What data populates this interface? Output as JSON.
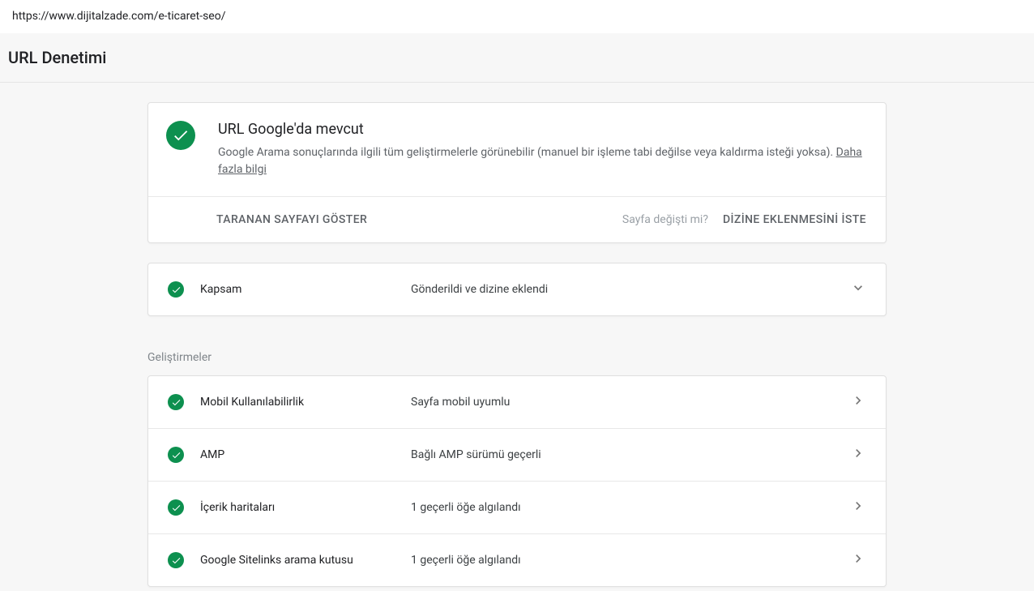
{
  "urlBar": {
    "value": "https://www.dijitalzade.com/e-ticaret-seo/"
  },
  "pageTitle": "URL Denetimi",
  "status": {
    "title": "URL Google'da mevcut",
    "description": "Google Arama sonuçlarında ilgili tüm geliştirmelerle görünebilir (manuel bir işleme tabi değilse veya kaldırma isteği yoksa). ",
    "moreInfo": "Daha fazla bilgi"
  },
  "actions": {
    "viewTested": "TARANAN SAYFAYI GÖSTER",
    "pageChangedHint": "Sayfa değişti mi?",
    "requestIndexing": "DİZİNE EKLENMESİNİ İSTE"
  },
  "coverage": {
    "label": "Kapsam",
    "value": "Gönderildi ve dizine eklendi"
  },
  "enhancementsHeader": "Geliştirmeler",
  "enhancements": [
    {
      "label": "Mobil Kullanılabilirlik",
      "value": "Sayfa mobil uyumlu"
    },
    {
      "label": "AMP",
      "value": "Bağlı AMP sürümü geçerli"
    },
    {
      "label": "İçerik haritaları",
      "value": "1 geçerli öğe algılandı"
    },
    {
      "label": "Google Sitelinks arama kutusu",
      "value": "1 geçerli öğe algılandı"
    }
  ]
}
